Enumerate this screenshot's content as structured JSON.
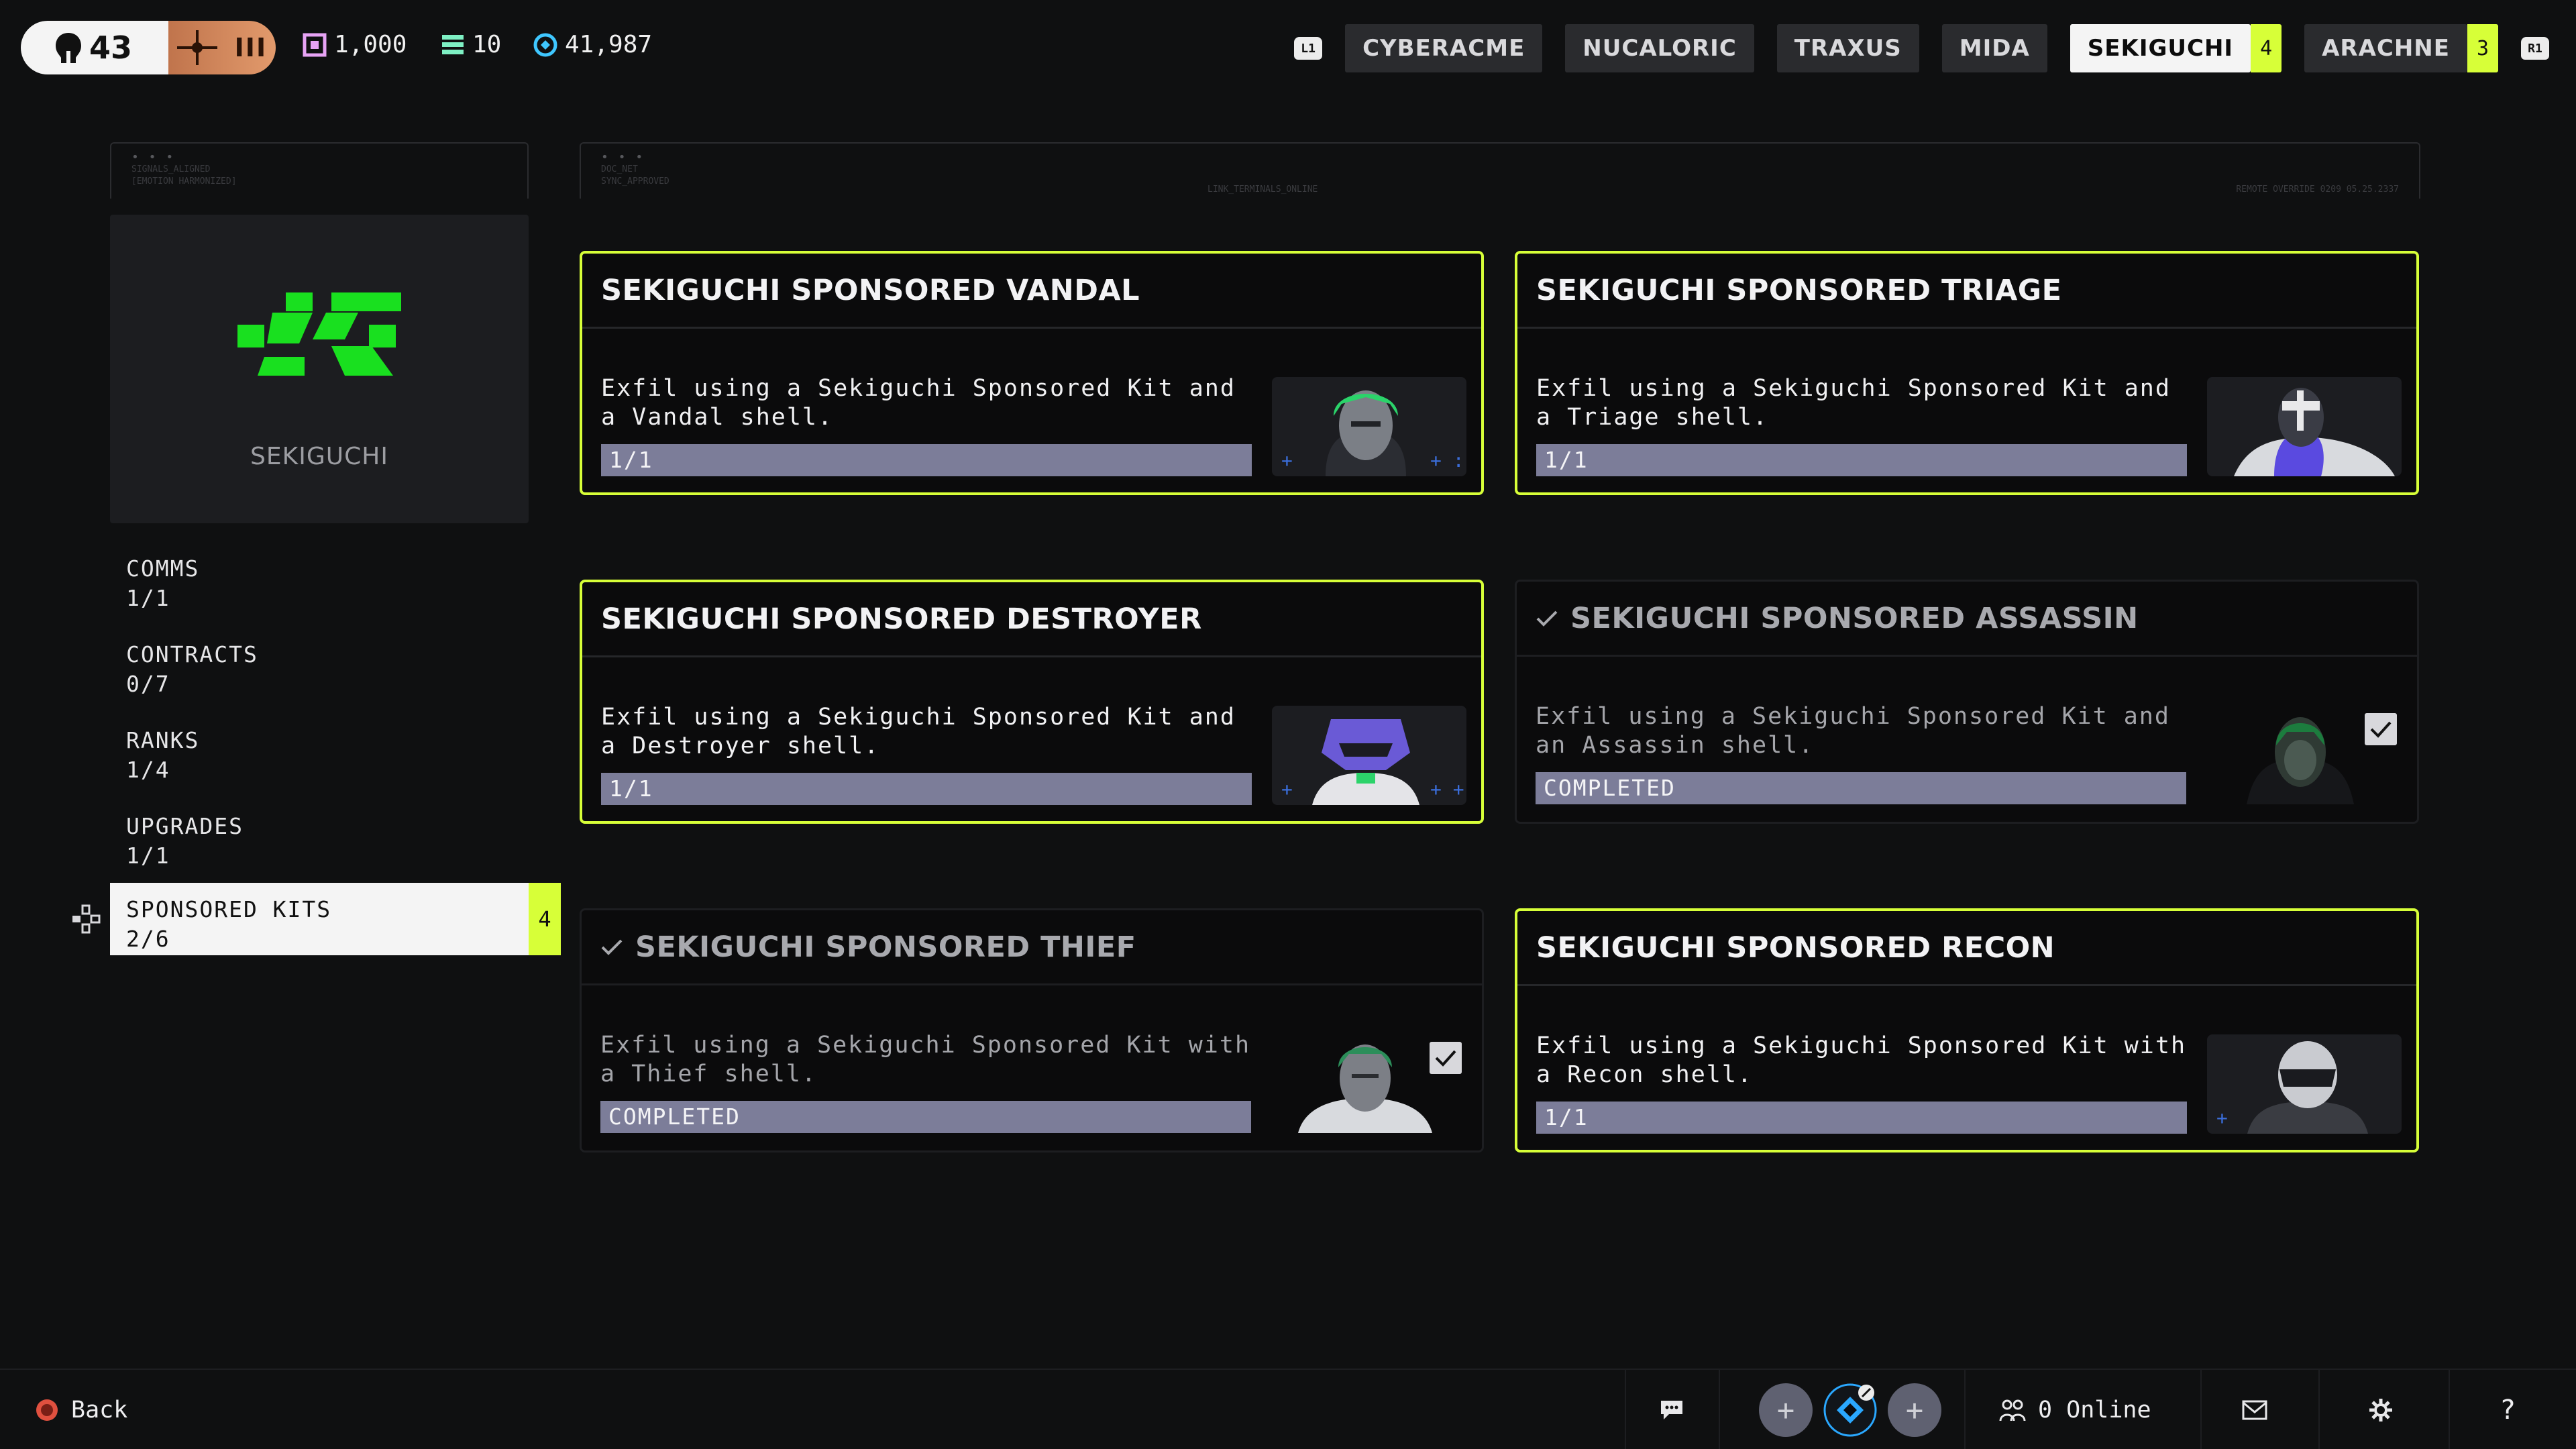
{
  "top": {
    "level": "43",
    "rank_label": "III",
    "currencies": [
      {
        "icon": "box-currency-icon",
        "value": "1,000",
        "color": "#e7a3f5"
      },
      {
        "icon": "stack-currency-icon",
        "value": "10",
        "color": "#7ef0c4"
      },
      {
        "icon": "credit-currency-icon",
        "value": "41,987",
        "color": "#3fc7ff"
      }
    ],
    "shoulder_left": "L1",
    "shoulder_right": "R1",
    "factions": [
      {
        "label": "CYBERACME",
        "badge": ""
      },
      {
        "label": "NUCALORIC",
        "badge": ""
      },
      {
        "label": "TRAXUS",
        "badge": ""
      },
      {
        "label": "MIDA",
        "badge": ""
      },
      {
        "label": "SEKIGUCHI",
        "badge": "4",
        "active": true
      },
      {
        "label": "ARACHNE",
        "badge": "3"
      }
    ]
  },
  "sidebar": {
    "faction_name": "SEKIGUCHI",
    "deco_left": [
      "SIGNALS_ALIGNED",
      "[EMOTION HARMONIZED]"
    ],
    "deco_main_left": [
      "DOC_NET",
      "SYNC_APPROVED"
    ],
    "deco_main_mid": "LINK_TERMINALS_ONLINE",
    "deco_main_right": "REMOTE OVERRIDE 0209 05.25.2337",
    "items": [
      {
        "label": "COMMS",
        "progress": "1/1"
      },
      {
        "label": "CONTRACTS",
        "progress": "0/7"
      },
      {
        "label": "RANKS",
        "progress": "1/4"
      },
      {
        "label": "UPGRADES",
        "progress": "1/1"
      },
      {
        "label": "SPONSORED KITS",
        "progress": "2/6",
        "badge": "4",
        "active": true
      }
    ]
  },
  "cards": [
    {
      "title": "SEKIGUCHI SPONSORED VANDAL",
      "desc": "Exfil using a Sekiguchi Sponsored Kit and a Vandal shell.",
      "status": "1/1",
      "completed": false,
      "progress": 1.0
    },
    {
      "title": "SEKIGUCHI SPONSORED TRIAGE",
      "desc": "Exfil using a Sekiguchi Sponsored Kit and a Triage shell.",
      "status": "1/1",
      "completed": false,
      "progress": 1.0
    },
    {
      "title": "SEKIGUCHI SPONSORED DESTROYER",
      "desc": "Exfil using a Sekiguchi Sponsored Kit and a Destroyer shell.",
      "status": "1/1",
      "completed": false,
      "progress": 1.0
    },
    {
      "title": "SEKIGUCHI SPONSORED ASSASSIN",
      "desc": "Exfil using a Sekiguchi Sponsored Kit and an Assassin shell.",
      "status": "COMPLETED",
      "completed": true,
      "progress": 1.0
    },
    {
      "title": "SEKIGUCHI SPONSORED THIEF",
      "desc": "Exfil using a Sekiguchi Sponsored Kit with a Thief shell.",
      "status": "COMPLETED",
      "completed": true,
      "progress": 1.0
    },
    {
      "title": "SEKIGUCHI SPONSORED RECON",
      "desc": "Exfil using a Sekiguchi Sponsored Kit with a Recon shell.",
      "status": "1/1",
      "completed": false,
      "progress": 1.0
    }
  ],
  "bottom": {
    "back_label": "Back",
    "online_label": "0 Online"
  },
  "colors": {
    "accent": "#d7ff38",
    "emblem": "#19e01f",
    "bar": "#6d6e88"
  }
}
